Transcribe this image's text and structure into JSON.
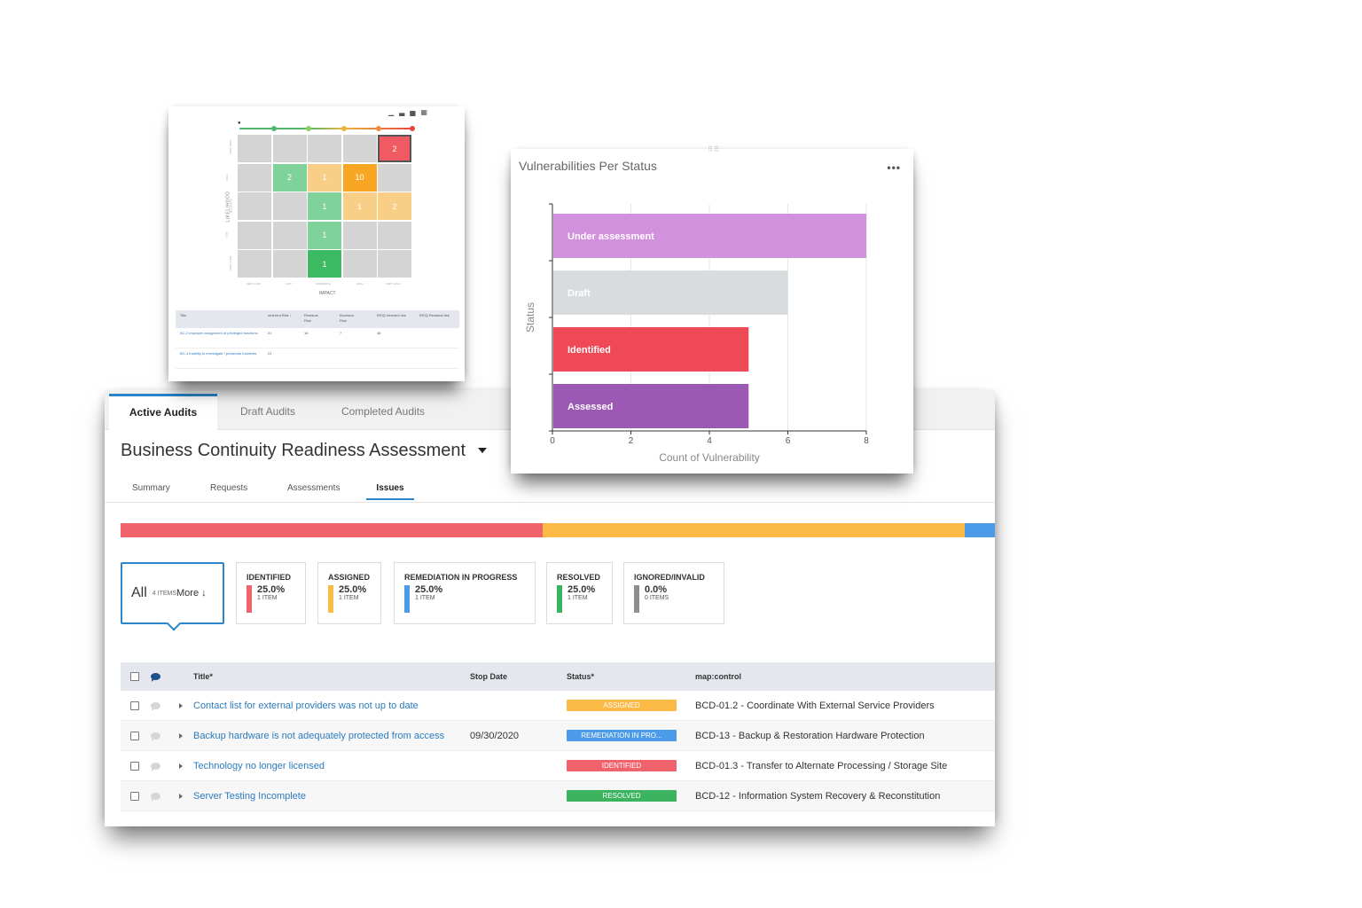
{
  "tabs": [
    {
      "label": "Active Audits",
      "active": true
    },
    {
      "label": "Draft Audits",
      "active": false
    },
    {
      "label": "Completed Audits",
      "active": false
    }
  ],
  "page_title": "Business Continuity Readiness Assessment",
  "subtabs": [
    {
      "label": "Summary",
      "active": false
    },
    {
      "label": "Requests",
      "active": false
    },
    {
      "label": "Assessments",
      "active": false
    },
    {
      "label": "Issues",
      "active": true
    }
  ],
  "progress_segments": [
    {
      "color": "#f0636c",
      "fraction": 0.483
    },
    {
      "color": "#fbba45",
      "fraction": 0.483
    },
    {
      "color": "#4c9be8",
      "fraction": 0.034
    }
  ],
  "filter": {
    "all_label": "All",
    "all_count": "4 ITEMS",
    "more_label": "More ↓",
    "cards": [
      {
        "name": "IDENTIFIED",
        "pct": "25.0%",
        "items": "1 ITEM",
        "color": "#f0636c"
      },
      {
        "name": "ASSIGNED",
        "pct": "25.0%",
        "items": "1 ITEM",
        "color": "#fbba45"
      },
      {
        "name": "REMEDIATION IN PROGRESS",
        "pct": "25.0%",
        "items": "1 ITEM",
        "color": "#4c9be8"
      },
      {
        "name": "RESOLVED",
        "pct": "25.0%",
        "items": "1 ITEM",
        "color": "#3bb35f"
      },
      {
        "name": "IGNORED/INVALID",
        "pct": "0.0%",
        "items": "0 ITEMS",
        "color": "#8e8e8e"
      }
    ]
  },
  "table": {
    "headers": {
      "title": "Title*",
      "stop_date": "Stop Date",
      "status": "Status*",
      "control": "map:control"
    },
    "rows": [
      {
        "title": "Contact list for external providers was not up to date",
        "stop_date": "",
        "status": "ASSIGNED",
        "status_color": "#fbba45",
        "control": "BCD-01.2 - Coordinate With External Service Providers"
      },
      {
        "title": "Backup hardware is not adequately protected from access",
        "stop_date": "09/30/2020",
        "status": "REMEDIATION IN PRO...",
        "status_color": "#4c9be8",
        "control": "BCD-13 - Backup & Restoration Hardware Protection"
      },
      {
        "title": "Technology no longer licensed",
        "stop_date": "",
        "status": "IDENTIFIED",
        "status_color": "#f0636c",
        "control": "BCD-01.3 - Transfer to Alternate Processing / Storage Site"
      },
      {
        "title": "Server Testing Incomplete",
        "stop_date": "",
        "status": "RESOLVED",
        "status_color": "#3bb35f",
        "control": "BCD-12 - Information System Recovery & Reconstitution"
      }
    ]
  },
  "risk_matrix": {
    "y_axis_label": "LIKELIHOOD",
    "x_axis_label": "IMPACT",
    "y_ticks": [
      "VERY HIGH",
      "HIGH",
      "MODERATE",
      "LOW",
      "VERY LOW"
    ],
    "x_ticks": [
      "VERY LOW",
      "LOW",
      "MODERATE",
      "HIGH",
      "VERY HIGH"
    ],
    "cells": [
      {
        "row": 0,
        "col": 4,
        "value": "2",
        "color": "#f05a63",
        "selected": true
      },
      {
        "row": 1,
        "col": 1,
        "value": "2",
        "color": "#7fd39a"
      },
      {
        "row": 1,
        "col": 2,
        "value": "1",
        "color": "#f9cf87"
      },
      {
        "row": 1,
        "col": 3,
        "value": "10",
        "color": "#f8a623"
      },
      {
        "row": 2,
        "col": 2,
        "value": "1",
        "color": "#7fd39a"
      },
      {
        "row": 2,
        "col": 3,
        "value": "1",
        "color": "#f9cf87"
      },
      {
        "row": 2,
        "col": 4,
        "value": "2",
        "color": "#f9cf87"
      },
      {
        "row": 3,
        "col": 2,
        "value": "1",
        "color": "#7fd39a"
      },
      {
        "row": 4,
        "col": 2,
        "value": "1",
        "color": "#3cba62"
      }
    ],
    "table_headers": [
      "Title",
      "Inherent Risk ↓",
      "Residual Risk",
      "Business Risk",
      "RISQ Inherent risk",
      "RISQ Residual risk"
    ],
    "table_rows": [
      [
        "AC-2 Improper assignment of privileged functions",
        "21",
        "16",
        "7",
        "48",
        ""
      ],
      [
        "BC-4 Inability to investigate / prosecute incidents",
        "21",
        "",
        "",
        "",
        ""
      ]
    ]
  },
  "chart_title": "Vulnerabilities Per Status",
  "chart_data": {
    "type": "bar",
    "orientation": "horizontal",
    "title": "Vulnerabilities Per Status",
    "categories": [
      "Under assessment",
      "Draft",
      "Identified",
      "Assessed"
    ],
    "values": [
      8,
      6,
      5,
      5
    ],
    "colors": [
      "#d291dd",
      "#d9dcdf",
      "#ef4857",
      "#9b59b3"
    ],
    "xlabel": "Count of Vulnerability",
    "ylabel": "Status",
    "xlim": [
      0,
      8
    ],
    "xticks": [
      0,
      2,
      4,
      6,
      8
    ],
    "grid": true,
    "legend": "none"
  }
}
